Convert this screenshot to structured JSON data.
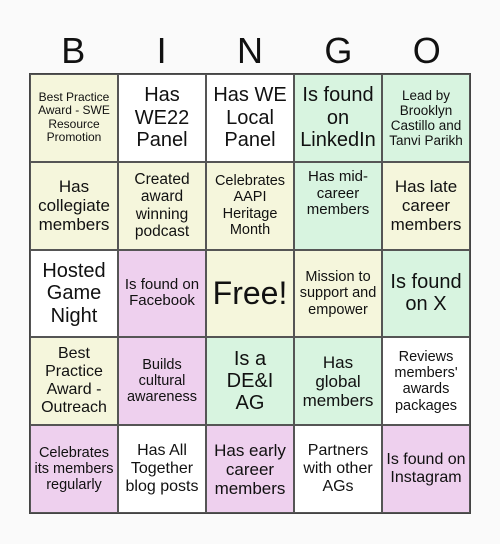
{
  "header": {
    "letters": [
      "B",
      "I",
      "N",
      "G",
      "O"
    ]
  },
  "colors": {
    "cream": "#f5f6dc",
    "green": "#d8f4e0",
    "pink": "#eed0ee",
    "white": "#ffffff"
  },
  "cells": [
    {
      "text": "Best Practice Award - SWE Resource Promotion",
      "color": "cream"
    },
    {
      "text": "Has WE22 Panel",
      "color": "white"
    },
    {
      "text": "Has WE Local Panel",
      "color": "white"
    },
    {
      "text": "Is found on LinkedIn",
      "color": "green"
    },
    {
      "text": "Lead by Brooklyn Castillo and Tanvi Parikh",
      "color": "green"
    },
    {
      "text": "Has collegiate members",
      "color": "cream"
    },
    {
      "text": "Created award winning podcast",
      "color": "cream"
    },
    {
      "text": "Celebrates AAPI Heritage Month",
      "color": "cream"
    },
    {
      "text": "Has mid-career members",
      "color": "green"
    },
    {
      "text": "Has late career members",
      "color": "cream"
    },
    {
      "text": "Hosted Game Night",
      "color": "white"
    },
    {
      "text": "Is found on Facebook",
      "color": "pink"
    },
    {
      "text": "Free!",
      "color": "cream"
    },
    {
      "text": "Mission to support and empower",
      "color": "cream"
    },
    {
      "text": "Is found on X",
      "color": "green"
    },
    {
      "text": "Best Practice Award - Outreach",
      "color": "cream"
    },
    {
      "text": "Builds cultural awareness",
      "color": "pink"
    },
    {
      "text": "Is a DE&I AG",
      "color": "green"
    },
    {
      "text": "Has global members",
      "color": "green"
    },
    {
      "text": "Reviews members' awards packages",
      "color": "white"
    },
    {
      "text": "Celebrates its members regularly",
      "color": "pink"
    },
    {
      "text": "Has All Together blog posts",
      "color": "white"
    },
    {
      "text": "Has early career members",
      "color": "pink"
    },
    {
      "text": "Partners with other AGs",
      "color": "white"
    },
    {
      "text": "Is found on Instagram",
      "color": "pink"
    }
  ]
}
